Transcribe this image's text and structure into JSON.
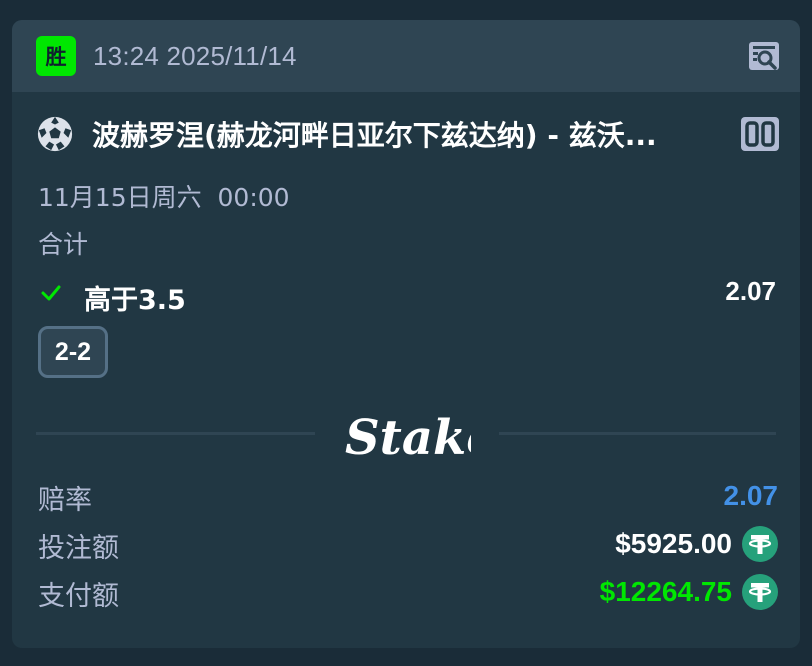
{
  "status_badge": "胜",
  "bet_time": "13:24 2025/11/14",
  "event": {
    "name": "波赫罗涅(赫龙河畔日亚尔下兹达纳) - 兹沃...",
    "date": "11月15日周六  00:00"
  },
  "market": "合计",
  "selection": {
    "label": "高于3.5",
    "odds": "2.07"
  },
  "score": "2-2",
  "brand": "Stake",
  "summary": {
    "odds_label": "赔率",
    "odds_value": "2.07",
    "stake_label": "投注额",
    "stake_value": "$5925.00",
    "payout_label": "支付额",
    "payout_value": "$12264.75"
  },
  "icons": {
    "receipt": "receipt-search-icon",
    "sport": "soccer-ball-icon",
    "scoreboard": "scoreboard-icon",
    "check": "check-icon",
    "currency": "tether-usdt-icon"
  },
  "colors": {
    "background": "#1a2c38",
    "card": "#213743",
    "header": "#2f4553",
    "win_green": "#00e701",
    "odds_blue": "#4391e7",
    "muted_text": "#b1bad3",
    "tether": "#26a17b"
  }
}
